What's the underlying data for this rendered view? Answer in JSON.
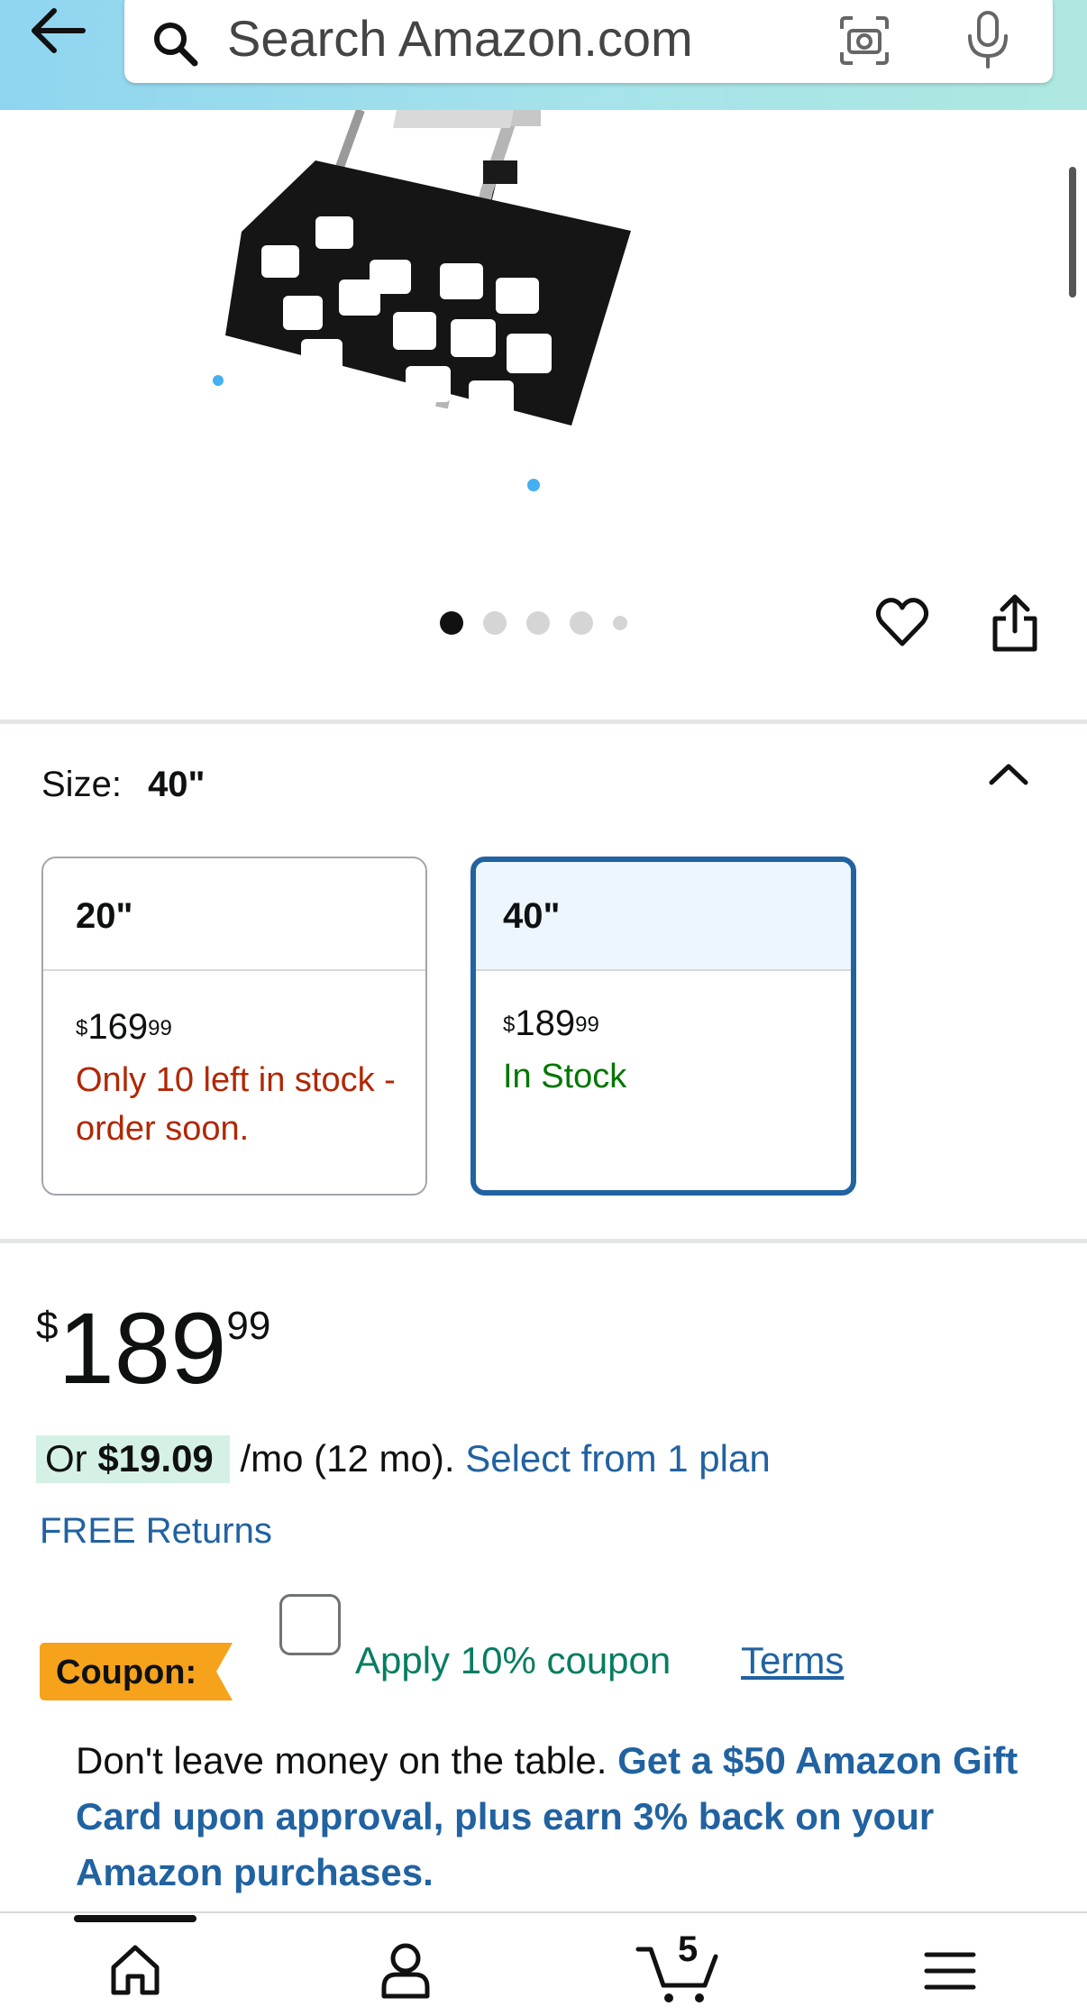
{
  "header": {
    "search_placeholder": "Search Amazon.com",
    "icons": [
      "back-arrow-icon",
      "search-icon",
      "camera-icon",
      "mic-icon"
    ]
  },
  "gallery": {
    "image_count": 5,
    "active_index": 0,
    "icons": [
      "heart-icon",
      "share-icon"
    ]
  },
  "size": {
    "label": "Size:",
    "selected_value": "40\"",
    "options": [
      {
        "name": "20\"",
        "price_symbol": "$",
        "price_whole": "169",
        "price_fraction": "99",
        "availability": "Only 10 left in stock - order soon.",
        "availability_color": "#b12704"
      },
      {
        "name": "40\"",
        "price_symbol": "$",
        "price_whole": "189",
        "price_fraction": "99",
        "availability": "In Stock",
        "availability_color": "#007600",
        "selected": true
      }
    ]
  },
  "price": {
    "symbol": "$",
    "whole": "189",
    "fraction": "99"
  },
  "installment": {
    "prefix": "Or ",
    "amount": "$19.09",
    "suffix": " /mo (12 mo). ",
    "link": "Select from 1 plan"
  },
  "returns": "FREE Returns",
  "coupon": {
    "badge": "Coupon:",
    "apply_text": "Apply 10% coupon",
    "terms": "Terms"
  },
  "promo": {
    "text": "Don't leave money on the table. ",
    "link": "Get a $50 Amazon Gift Card upon approval, plus earn 3% back on your Amazon purchases."
  },
  "bottom_nav": {
    "cart_count": "5",
    "items": [
      "home-icon",
      "account-icon",
      "cart-icon",
      "menu-icon"
    ]
  },
  "colors": {
    "link": "#2162a1",
    "selected_border": "#2162a1",
    "coupon_badge": "#f7a21b",
    "deal_green": "#067d62"
  }
}
